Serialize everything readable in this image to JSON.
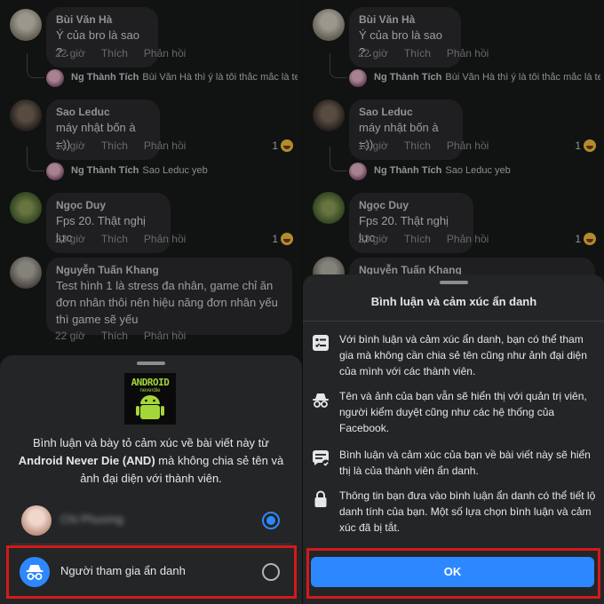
{
  "comments": [
    {
      "author": "Bùi Văn Hà",
      "text": "Ý của bro là sao ? .",
      "time": "22 giờ",
      "like": "Thích",
      "reply": "Phản hồi",
      "reactions": ""
    },
    {
      "author": "Sao Leduc",
      "text": "máy nhật bốn à =))",
      "time": "13 giờ",
      "like": "Thích",
      "reply": "Phản hồi",
      "reactions": "1"
    },
    {
      "author": "Ngọc Duy",
      "text": "Fps 20. Thật nghị lực",
      "time": "23 giờ",
      "like": "Thích",
      "reply": "Phản hồi",
      "reactions": "1"
    },
    {
      "author": "Nguyễn Tuấn Khang",
      "text": "Test hình 1 là stress đa nhân, game chỉ ăn\nđơn nhân thôi nên hiệu năng đơn nhân yếu\nthì game sẽ yếu",
      "time": "22 giờ",
      "like": "Thích",
      "reply": "Phản hồi",
      "reactions": ""
    }
  ],
  "replies": [
    {
      "author": "Ng Thành Tích",
      "text": "Bùi Văn Hà thì ý là tôi thắc mắc là te..."
    },
    {
      "author": "Ng Thành Tích",
      "text": "Sao Leduc yeb"
    }
  ],
  "anon_sheet": {
    "logo_text": "ANDROID",
    "logo_sub": "neverdie",
    "desc_before": "Bình luận và bày tỏ cảm xúc về bài viết này từ",
    "group_name": "Android Never Die (AND)",
    "desc_after": "mà không chia sẻ tên và ảnh đại diện với thành viên.",
    "profile_option": "Chi Phương",
    "anon_option": "Người tham gia ẩn danh"
  },
  "info_sheet": {
    "title": "Bình luận và cảm xúc ẩn danh",
    "items": [
      {
        "icon": "comment-list-icon",
        "text": "Với bình luận và cảm xúc ẩn danh, bạn có thể tham gia mà không cần chia sẻ tên cũng như ảnh đại diện của mình với các thành viên."
      },
      {
        "icon": "incognito-icon",
        "text": "Tên và ảnh của bạn vẫn sẽ hiển thị với quản trị viên, người kiểm duyệt cũng như các hệ thống của Facebook."
      },
      {
        "icon": "comment-check-icon",
        "text": "Bình luận và cảm xúc của bạn về bài viết này sẽ hiển thị là của thành viên ẩn danh."
      },
      {
        "icon": "lock-icon",
        "text": "Thông tin bạn đưa vào bình luận ẩn danh có thể tiết lộ danh tính của bạn. Một số lựa chọn bình luận và cảm xúc đã bị tắt."
      }
    ],
    "ok": "OK"
  },
  "colors": {
    "accent": "#2d88ff",
    "highlight": "#d41a1a",
    "sheet": "#242526"
  }
}
